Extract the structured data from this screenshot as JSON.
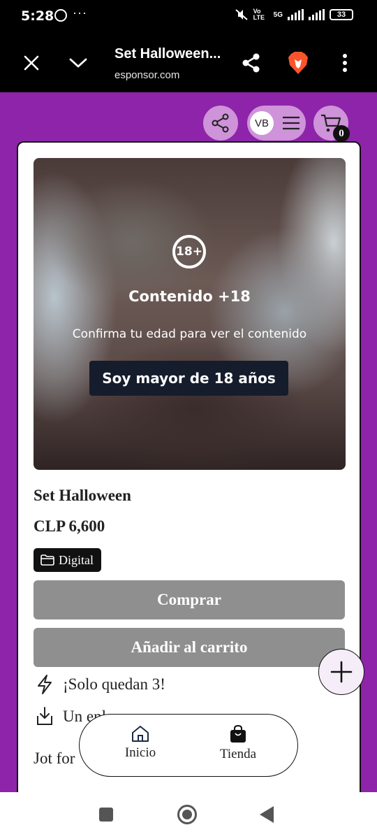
{
  "status_bar": {
    "time": "5:28",
    "network_label": "5G",
    "volte_label": "Vo LTE",
    "battery": "33",
    "icons": [
      "whatsapp-icon",
      "more-dots-icon",
      "mute-icon",
      "signal-icon",
      "battery-icon"
    ]
  },
  "browser": {
    "title": "Set Halloween...",
    "url": "esponsor.com",
    "icons": [
      "close-icon",
      "chevron-down-icon",
      "share-icon",
      "brave-lion-icon",
      "menu-dots-icon"
    ]
  },
  "header": {
    "avatar_initials": "VB",
    "cart_count": "0",
    "icons": [
      "share-icon",
      "hamburger-icon",
      "cart-icon"
    ]
  },
  "age_gate": {
    "badge": "18+",
    "title": "Contenido +18",
    "subtitle": "Confirma tu edad para ver el contenido",
    "button": "Soy mayor de 18 años"
  },
  "product": {
    "title": "Set Halloween",
    "price": "CLP 6,600",
    "category": "Digital",
    "buy_label": "Comprar",
    "add_to_cart_label": "Añadir al carrito",
    "stock_note": "¡Solo quedan 3!",
    "delivery_note": "Un enlace",
    "description_start": "Jot for"
  },
  "bottom_nav": {
    "items": [
      {
        "label": "Inicio",
        "icon": "home-icon"
      },
      {
        "label": "Tienda",
        "icon": "shopping-bag-icon"
      }
    ]
  },
  "colors": {
    "page_background": "#8e24aa",
    "header_button": "#ce93d8",
    "age_button": "#151c2c",
    "disabled_button": "#8f8f8f"
  }
}
